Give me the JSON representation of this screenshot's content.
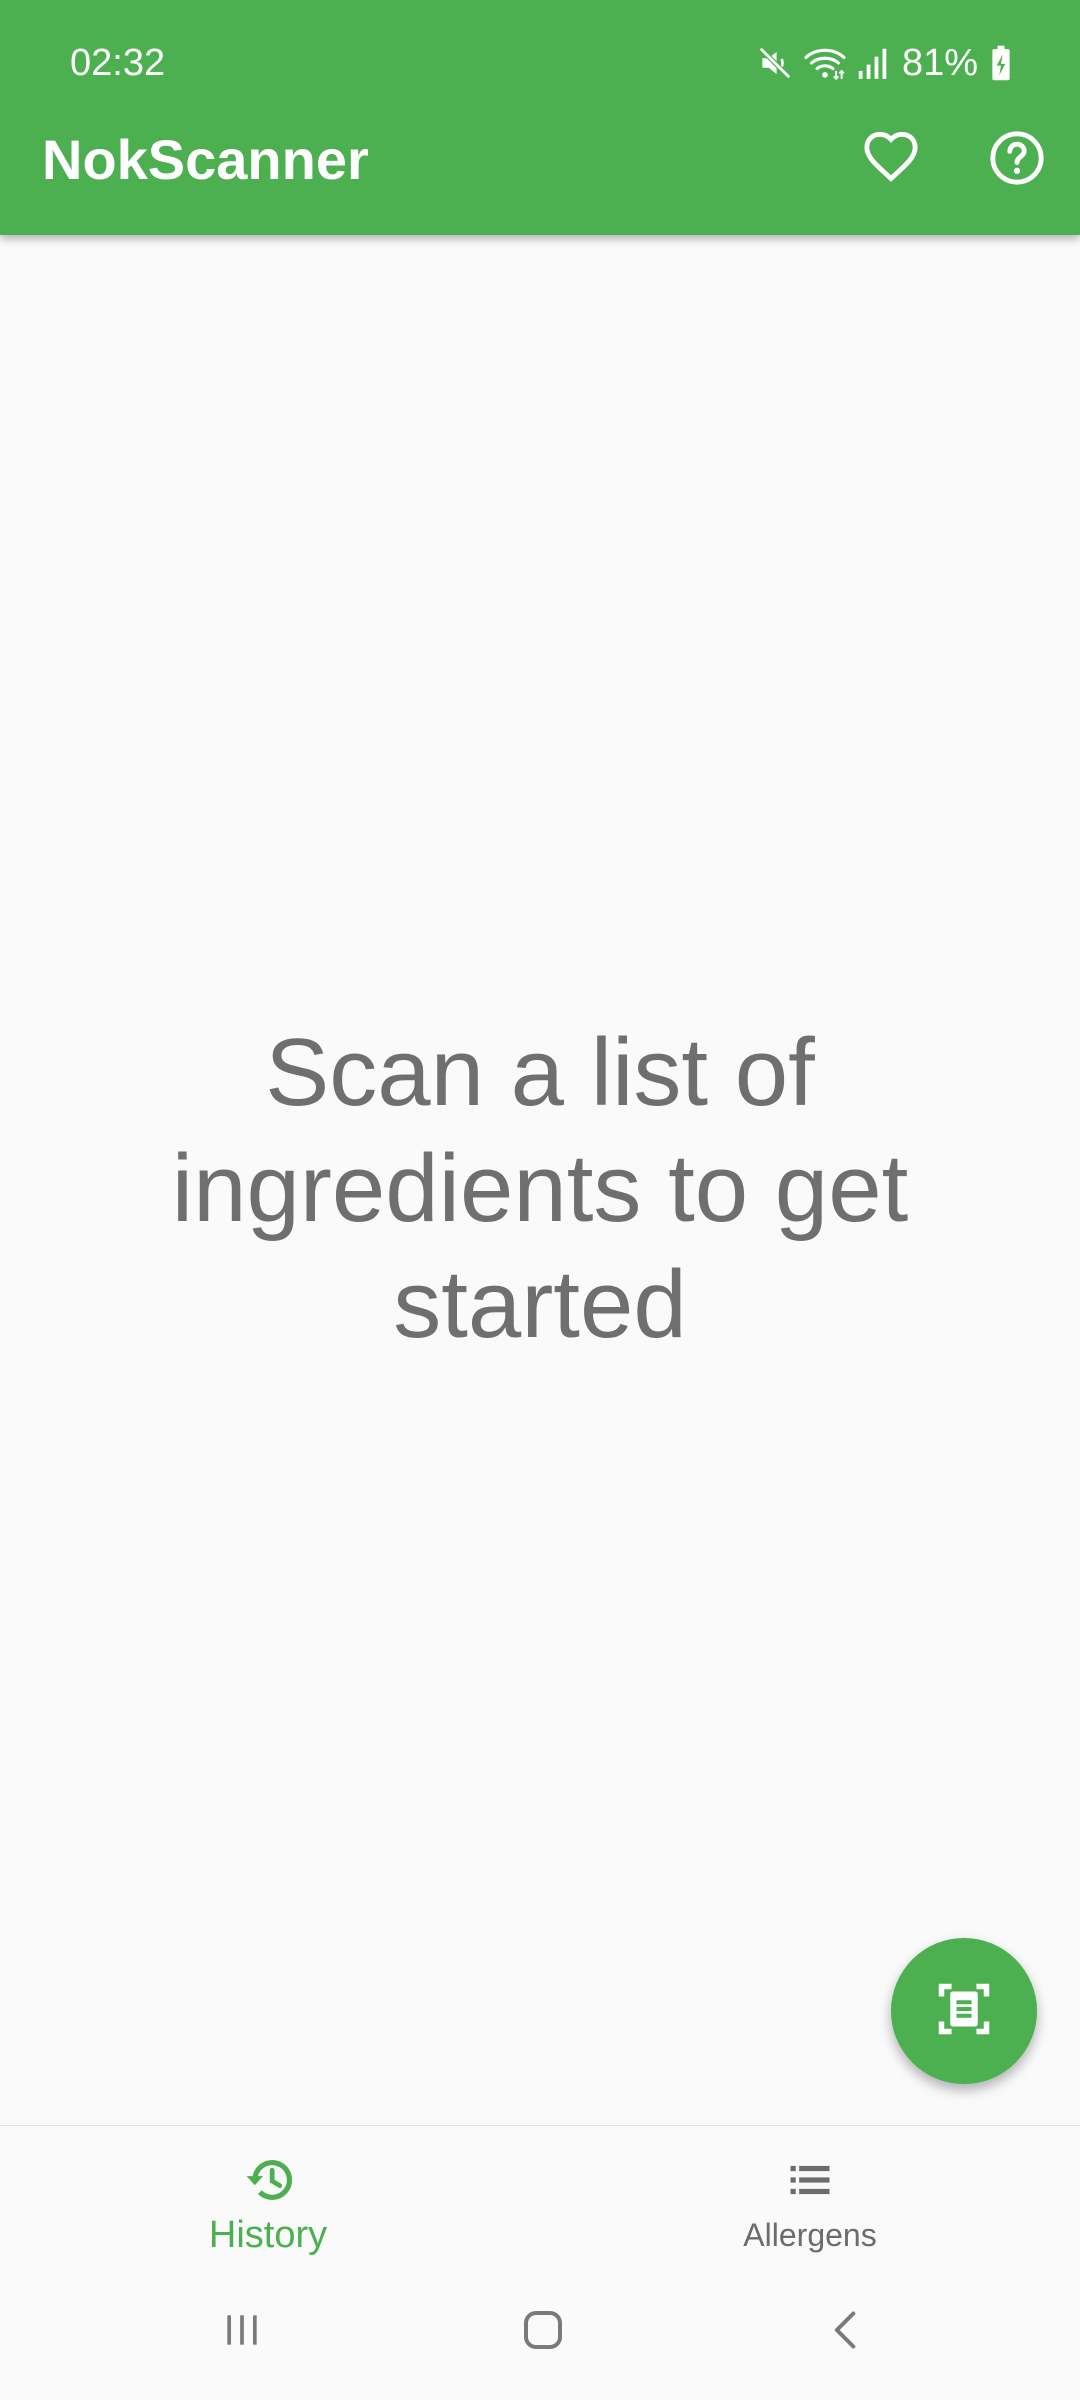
{
  "status_bar": {
    "time": "02:32",
    "battery_percent": "81%",
    "icons": [
      "mute-icon",
      "wifi-icon",
      "signal-icon",
      "battery-charging-icon"
    ]
  },
  "app_bar": {
    "title": "NokScanner",
    "actions": [
      "heart-icon",
      "help-circle-icon"
    ]
  },
  "main": {
    "empty_message": "Scan a list of ingredients to get started"
  },
  "fab": {
    "icon": "document-scanner-icon"
  },
  "bottom_nav": {
    "items": [
      {
        "label": "History",
        "icon": "history-icon",
        "active": true
      },
      {
        "label": "Allergens",
        "icon": "list-icon",
        "active": false
      }
    ]
  },
  "system_nav": {
    "buttons": [
      "recents-icon",
      "home-icon",
      "back-icon"
    ]
  },
  "colors": {
    "primary": "#4caf50",
    "text_muted": "#6f6f6f",
    "background": "#fafafa"
  }
}
